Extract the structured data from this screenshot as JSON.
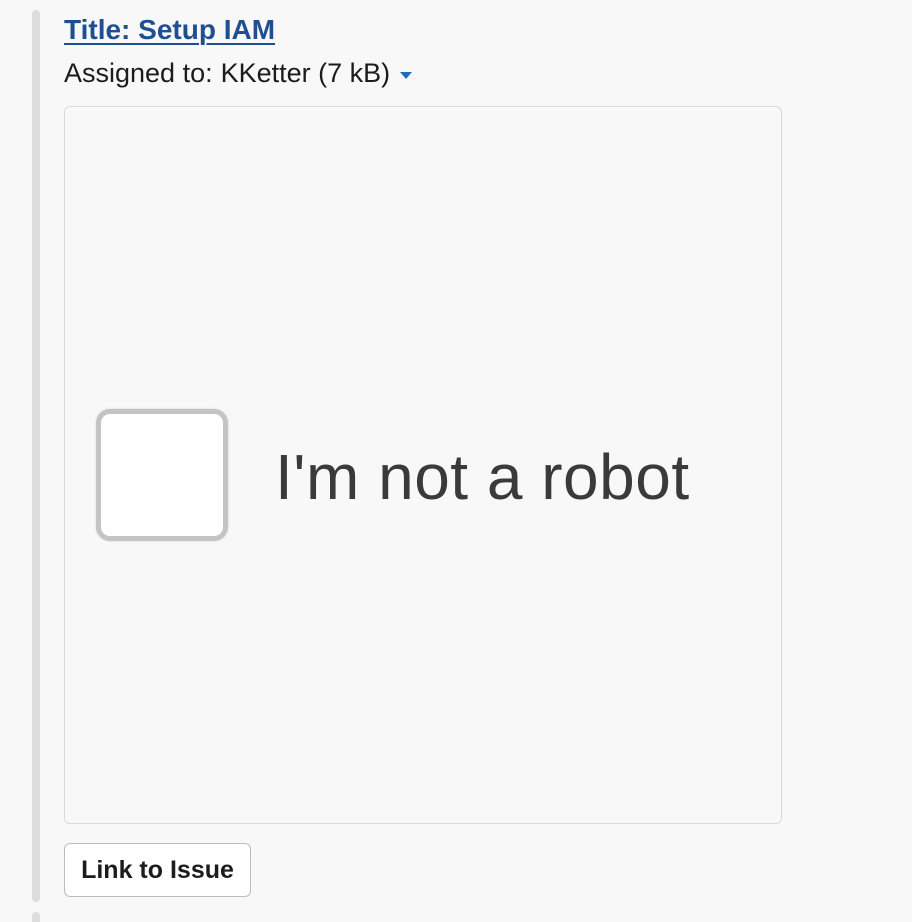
{
  "file": {
    "title_link": "Title: Setup IAM",
    "meta_prefix": "Assigned to:",
    "meta_value": "KKetter (7 kB)",
    "caret_icon": "chevron-down-icon"
  },
  "preview": {
    "checkbox_label": "I'm not a robot"
  },
  "actions": {
    "link_to_issue_label": "Link to Issue"
  },
  "colors": {
    "link": "#1d4f91",
    "caret": "#1d6fb8",
    "quote_bar": "#dddddd"
  }
}
